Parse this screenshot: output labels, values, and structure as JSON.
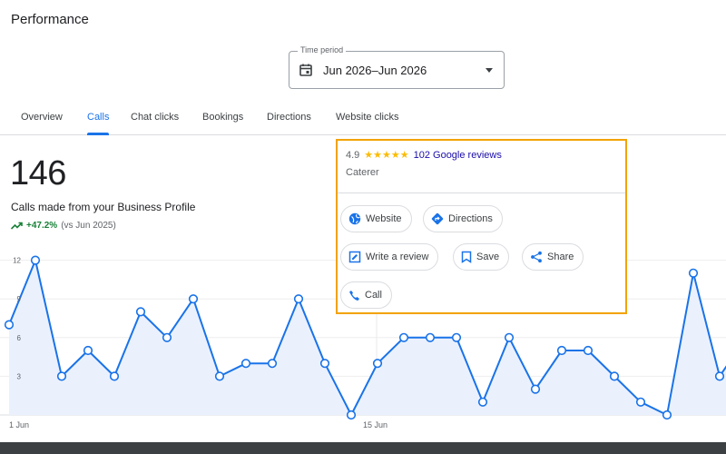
{
  "page": {
    "title": "Performance"
  },
  "time_period": {
    "label": "Time period",
    "value": "Jun 2026–Jun 2026",
    "icon": "calendar-icon"
  },
  "tabs": [
    {
      "label": "Overview"
    },
    {
      "label": "Calls",
      "active": true
    },
    {
      "label": "Chat clicks"
    },
    {
      "label": "Bookings"
    },
    {
      "label": "Directions"
    },
    {
      "label": "Website clicks"
    }
  ],
  "metric": {
    "value": "146",
    "caption": "Calls made from your Business Profile",
    "change": "+47.2%",
    "comparison": "(vs Jun 2025)"
  },
  "business_card": {
    "rating": "4.9",
    "stars": "★★★★★",
    "reviews": "102 Google reviews",
    "category": "Caterer",
    "actions": {
      "website": "Website",
      "directions": "Directions",
      "write_review": "Write a review",
      "save": "Save",
      "share": "Share",
      "call": "Call"
    }
  },
  "colors": {
    "accent": "#1a73e8",
    "highlight_border": "#f2a300",
    "positive": "#188038",
    "star": "#fbbc04"
  },
  "chart_data": {
    "type": "line",
    "title": "",
    "xlabel": "",
    "ylabel": "",
    "x_tick_labels": [
      "1 Jun",
      "15 Jun"
    ],
    "y_tick_labels": [
      "3",
      "6",
      "9",
      "12"
    ],
    "ylim": [
      0,
      12
    ],
    "grid": true,
    "series": [
      {
        "values": [
          7,
          12,
          3,
          5,
          3,
          8,
          6,
          9,
          3,
          4,
          4,
          9,
          4,
          0,
          4,
          6,
          6,
          6,
          1,
          6,
          2,
          5,
          5,
          3,
          1,
          0,
          11,
          3,
          6
        ]
      }
    ]
  }
}
